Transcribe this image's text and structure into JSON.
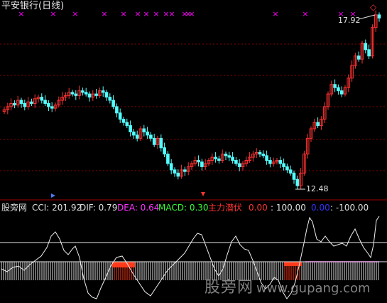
{
  "window": {
    "title": "平安银行(日线)"
  },
  "price_panel": {
    "high_label": "17.92",
    "low_label": "12.48",
    "marker_glyph": "×",
    "diamond_glyph": "◇",
    "colors": {
      "up": "#ff3232",
      "down": "#54ffff",
      "grid": "#8b0000",
      "marker": "#ff00ff"
    }
  },
  "indicator_bar": {
    "name": "股旁网",
    "cci": "CCI: 201.92",
    "dif": "DIF: 0.79",
    "dea": "DEA: 0.64",
    "macd": "MACD: 0.30",
    "zhuli_label": "主力潜伏",
    "zhuli_value": "0.00",
    "level_100": ": 100.00",
    "blue_value": "0.00",
    "level_neg100": ": -100.00",
    "colors": {
      "white": "#e0e0e0",
      "dea": "#ff33ff",
      "macd": "#33ff33",
      "zhuli": "#ff3333",
      "blue": "#3333ff"
    }
  },
  "watermark": {
    "text": "股旁网",
    "url": "www.gupang.com"
  },
  "chart_data": {
    "type": "candlestick",
    "series": [
      {
        "name": "price",
        "values": [
          14.9,
          15.0,
          15.1,
          15.05,
          15.2,
          15.1,
          15.0,
          15.15,
          15.1,
          15.25,
          15.3,
          15.2,
          15.1,
          15.0,
          14.95,
          15.05,
          15.2,
          15.3,
          15.35,
          15.45,
          15.4,
          15.35,
          15.5,
          15.45,
          15.4,
          15.3,
          15.4,
          15.35,
          15.5,
          15.45,
          15.3,
          15.2,
          15.0,
          14.8,
          14.6,
          14.5,
          14.4,
          14.2,
          14.1,
          14.0,
          14.3,
          14.2,
          14.1,
          14.0,
          13.8,
          14.0,
          13.7,
          13.5,
          13.2,
          13.0,
          12.9,
          12.8,
          13.0,
          12.95,
          13.1,
          13.2,
          13.3,
          13.25,
          13.1,
          13.2,
          13.3,
          13.4,
          13.35,
          13.3,
          13.5,
          13.45,
          13.4,
          13.3,
          13.2,
          13.1,
          13.2,
          13.3,
          13.4,
          13.5,
          13.55,
          13.5,
          13.45,
          13.3,
          13.2,
          13.25,
          13.3,
          13.2,
          13.1,
          13.0,
          12.9,
          12.7,
          12.5,
          12.9,
          13.5,
          14.0,
          14.3,
          14.5,
          14.4,
          14.6,
          15.0,
          15.4,
          15.7,
          15.6,
          15.5,
          15.4,
          15.6,
          15.9,
          16.3,
          16.6,
          16.5,
          17.0,
          16.8,
          16.6,
          17.5,
          17.9,
          17.8
        ]
      }
    ],
    "indicators": {
      "CCI": 201.92,
      "DIF": 0.79,
      "DEA": 0.64,
      "MACD": 0.3,
      "主力潜伏": 0.0,
      "levels": [
        100.0,
        -100.0
      ]
    }
  }
}
